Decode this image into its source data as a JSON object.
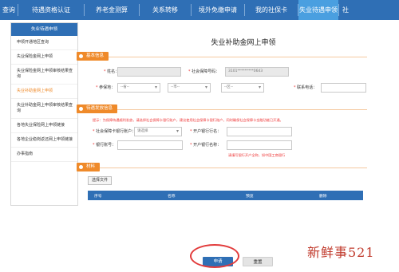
{
  "topnav": {
    "tabs": [
      {
        "label": "查询"
      },
      {
        "label": "待遇资格认证"
      },
      {
        "label": "养老金测算"
      },
      {
        "label": "关系转移"
      },
      {
        "label": "境外免缴申请"
      },
      {
        "label": "我的社保卡"
      },
      {
        "label": "失业待遇申领"
      },
      {
        "label": "社"
      }
    ],
    "active_index": 6
  },
  "sidebar": {
    "header": "失业待遇申领",
    "items": [
      {
        "label": "申领开通地区查询"
      },
      {
        "label": "失业保险金网上申领"
      },
      {
        "label": "失业保险金网上申领审核结果查询"
      },
      {
        "label": "失业补助金网上申领"
      },
      {
        "label": "失业补助金网上申领审核结果查询"
      },
      {
        "label": "各地失业保险网上申领链接"
      },
      {
        "label": "各地企业稳岗返还网上申领链接"
      },
      {
        "label": "办事指南"
      }
    ],
    "active_index": 3
  },
  "page_title": "失业补助金网上申领",
  "sections": {
    "basic": "基本信息",
    "payment": "待遇发放信息",
    "material": "材料"
  },
  "basic": {
    "name_label": "姓名：",
    "id_label": "社会保障号码：",
    "id_value": "3101*********0643",
    "insured_label": "参保地：",
    "select1": "--省--",
    "select2": "--市--",
    "select3": "--区--",
    "phone_label": "联系电话："
  },
  "payment": {
    "hint": "提示：为保障待遇顺利发放，请选择社会保障卡银行账户，建议使用社会保障卡银行账户，同时确保社会保障卡金融功能已开通。",
    "bank_label": "社会保障卡银行账户：",
    "bank_select": "请选择",
    "open_bank_label": "开户银行行名：",
    "account_label": "银行账号：",
    "account_name_label": "开户银行名称：",
    "account_hint": "请填写银行开户全称，如中国工商银行"
  },
  "material": {
    "attach_button": "选择文件",
    "columns": [
      "序号",
      "名称",
      "预览",
      "删除"
    ]
  },
  "buttons": {
    "submit": "申请",
    "reset": "重置"
  },
  "watermark": "新鲜事521",
  "colors": {
    "nav": "#2f6fb5",
    "accent": "#ef8a2a",
    "highlight": "#e23b3b"
  }
}
